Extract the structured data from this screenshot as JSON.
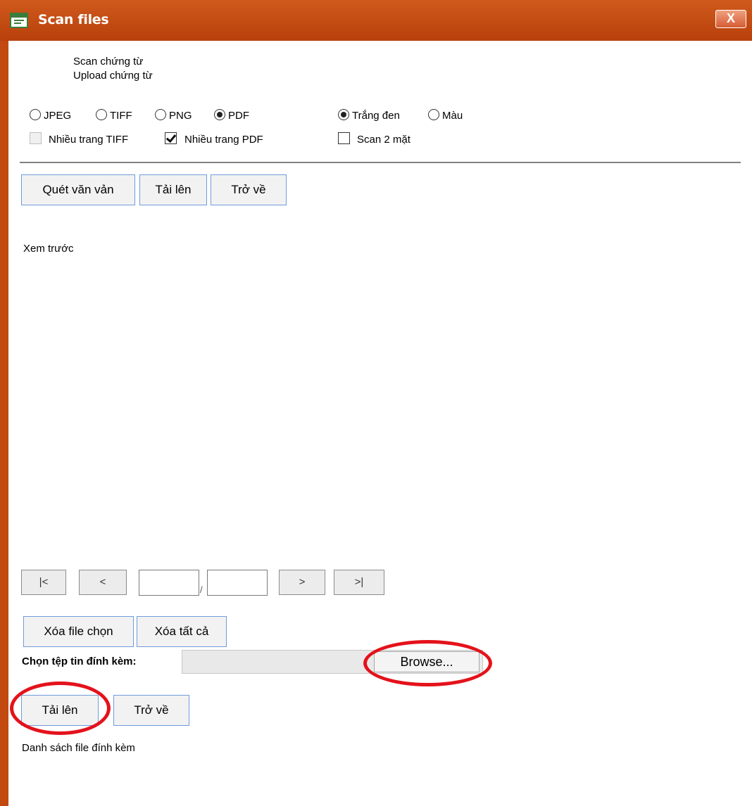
{
  "window": {
    "title": "Scan files",
    "close_glyph": "X"
  },
  "options": {
    "scan": "Scan chứng từ",
    "upload": "Upload chứng từ"
  },
  "formats": [
    {
      "label": "JPEG",
      "selected": false
    },
    {
      "label": "TIFF",
      "selected": false
    },
    {
      "label": "PNG",
      "selected": false
    },
    {
      "label": "PDF",
      "selected": true
    }
  ],
  "color_modes": [
    {
      "label": "Trắng đen",
      "selected": true
    },
    {
      "label": "Màu",
      "selected": false
    }
  ],
  "checkboxes": {
    "multi_tiff": {
      "label": "Nhiều trang TIFF",
      "checked": false,
      "disabled": true
    },
    "multi_pdf": {
      "label": "Nhiều trang PDF",
      "checked": true
    },
    "duplex": {
      "label": "Scan 2 mặt",
      "checked": false
    }
  },
  "scan_toolbar": {
    "scan": "Quét văn vản",
    "upload": "Tải lên",
    "back": "Trở về"
  },
  "preview_label": "Xem trước",
  "pager": {
    "first": "|<",
    "prev": "<",
    "separator": "/",
    "next": ">",
    "last": ">|",
    "current": "",
    "total": ""
  },
  "file_actions": {
    "delete_selected": "Xóa file chọn",
    "delete_all": "Xóa tất cả"
  },
  "attach": {
    "label": "Chọn tệp tin đính kèm:",
    "browse": "Browse..."
  },
  "upload_toolbar": {
    "upload": "Tải lên",
    "back": "Trở về"
  },
  "attachments_label": "Danh sách file đính kèm",
  "colors": {
    "title_bar": "#c2490f",
    "button_border": "#6f9bdc",
    "annotation": "#e4121b"
  }
}
